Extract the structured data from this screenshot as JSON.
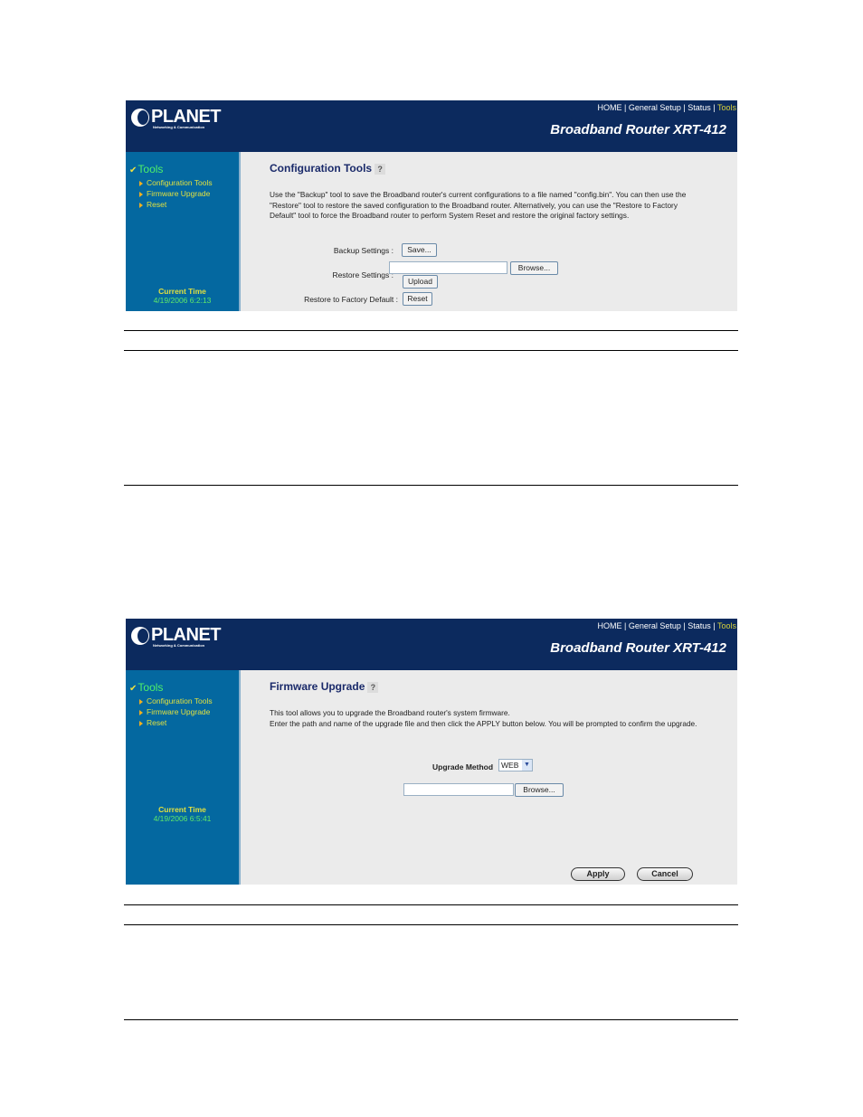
{
  "screenshots": [
    {
      "header": {
        "logo_text": "PLANET",
        "logo_tagline": "Networking & Communication",
        "nav": [
          "HOME",
          "General Setup",
          "Status",
          "Tools"
        ],
        "nav_separator": "|",
        "active_nav": "Tools",
        "router_title": "Broadband Router XRT-412"
      },
      "sidebar": {
        "section": "Tools",
        "items": [
          "Configuration Tools",
          "Firmware Upgrade",
          "Reset"
        ],
        "current_time_label": "Current Time",
        "current_time_value": "4/19/2006 6:2:13"
      },
      "content": {
        "title": "Configuration Tools",
        "help_icon": "?",
        "description": "Use the \"Backup\" tool to save the Broadband router's current configurations to a file named \"config.bin\". You can then use the \"Restore\" tool to restore the saved configuration to the Broadband router. Alternatively, you can use the \"Restore to Factory Default\" tool to force the Broadband router to perform System Reset and restore the original factory settings.",
        "backup_label": "Backup Settings :",
        "save_button": "Save...",
        "restore_label": "Restore Settings :",
        "restore_file_value": "",
        "browse_button": "Browse...",
        "upload_button": "Upload",
        "factory_label": "Restore to Factory Default :",
        "reset_button": "Reset"
      }
    },
    {
      "header": {
        "logo_text": "PLANET",
        "logo_tagline": "Networking & Communication",
        "nav": [
          "HOME",
          "General Setup",
          "Status",
          "Tools"
        ],
        "nav_separator": "|",
        "active_nav": "Tools",
        "router_title": "Broadband Router XRT-412"
      },
      "sidebar": {
        "section": "Tools",
        "items": [
          "Configuration Tools",
          "Firmware Upgrade",
          "Reset"
        ],
        "current_time_label": "Current Time",
        "current_time_value": "4/19/2006 6:5:41"
      },
      "content": {
        "title": "Firmware Upgrade",
        "help_icon": "?",
        "description_line1": "This tool allows you to upgrade the Broadband router's system firmware.",
        "description_line2": "Enter the path and name of the upgrade file and then click the APPLY button below. You will be prompted to confirm the upgrade.",
        "upgrade_method_label": "Upgrade Method",
        "upgrade_method_value": "WEB",
        "file_value": "",
        "browse_button": "Browse...",
        "apply_button": "Apply",
        "cancel_button": "Cancel"
      }
    }
  ]
}
